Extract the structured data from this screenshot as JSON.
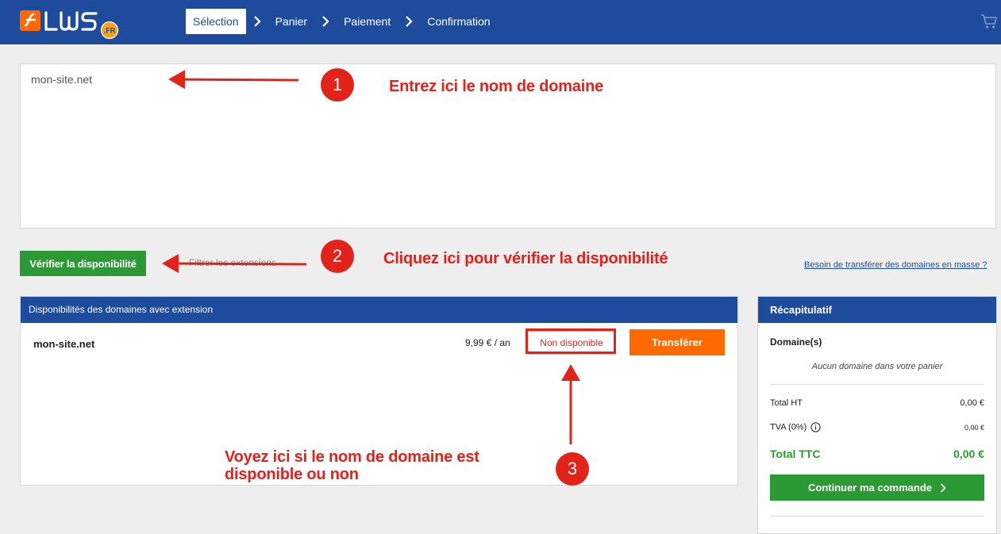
{
  "header": {
    "logo_text": "LWS",
    "logo_badge": ".FR",
    "steps": [
      "Sélection",
      "Panier",
      "Paiement",
      "Confirmation"
    ]
  },
  "search": {
    "value": "mon-site.net"
  },
  "actions": {
    "verify_label": "Vérifier la disponibilité",
    "filter_label": "Filtrer les extensions",
    "mass_transfer_label": "Besoin de transférer des domaines en masse ?"
  },
  "availability": {
    "title": "Disponibilités des domaines avec extension",
    "rows": [
      {
        "domain": "mon-site.net",
        "price": "9,99 € / an",
        "status": "Non disponible",
        "action": "Transférer"
      }
    ]
  },
  "summary": {
    "title": "Récapitulatif",
    "domains_label": "Domaine(s)",
    "empty_text": "Aucun domaine dans votre panier",
    "total_ht_label": "Total HT",
    "total_ht_value": "0,00 €",
    "tva_label": "TVA (0%)",
    "tva_value": "0,00 €",
    "total_ttc_label": "Total TTC",
    "total_ttc_value": "0,00 €",
    "continue_label": "Continuer ma commande"
  },
  "annotations": {
    "step1_text": "Entrez ici le nom de domaine",
    "step2_text": "Cliquez ici pour vérifier la disponibilité",
    "step3_line1": "Voyez ici si le nom de domaine est",
    "step3_line2": "disponible ou non",
    "badge1": "1",
    "badge2": "2",
    "badge3": "3"
  },
  "colors": {
    "header_blue": "#1e4b9b",
    "verify_green": "#2c9a34",
    "transfer_orange": "#ff6a00",
    "annotation_red": "#e2231a",
    "status_red": "#cc2b2b"
  },
  "icons": {
    "logo": "lws-logo-icon",
    "step_separator": "chevron-right-icon",
    "cart": "cart-icon",
    "tva_info": "info-icon",
    "continue_arrow": "chevron-right-icon"
  }
}
